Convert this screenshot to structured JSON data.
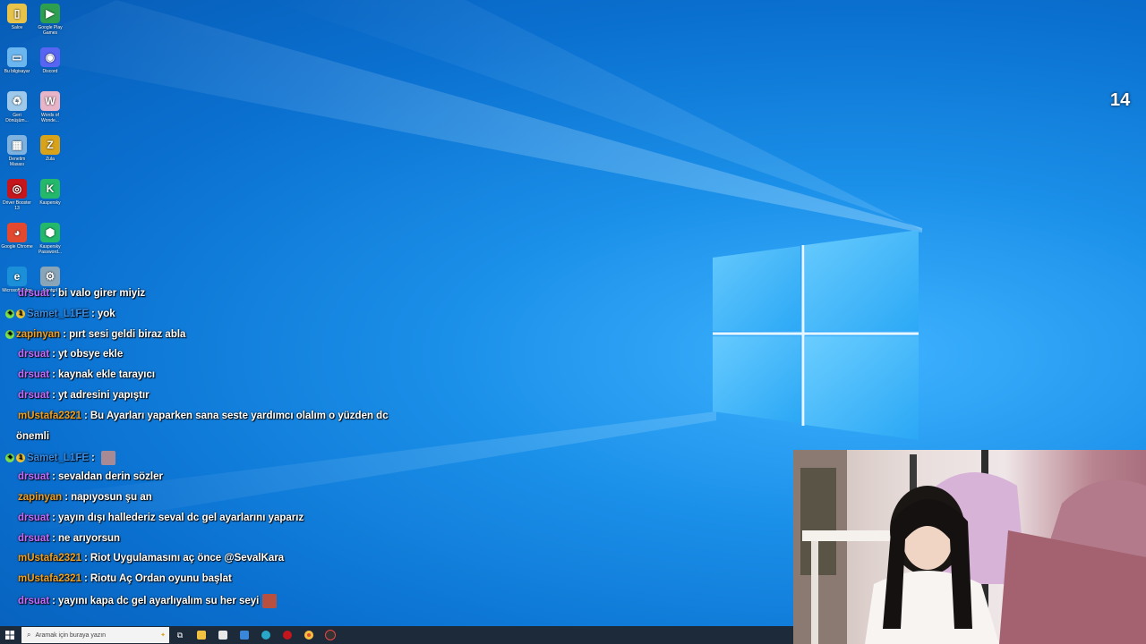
{
  "desktop": {
    "counter": "14",
    "icons": [
      {
        "label": "Salov",
        "color": "#e8c34a",
        "glyph": "▯"
      },
      {
        "label": "Google Play Games",
        "color": "#2e9e4f",
        "glyph": "▶"
      },
      {
        "label": "Bu bilgisayar",
        "color": "#6cb6f0",
        "glyph": "▭"
      },
      {
        "label": "Discord",
        "color": "#5865f2",
        "glyph": "◉"
      },
      {
        "label": "Geri Dönüşüm...",
        "color": "#9ec9ea",
        "glyph": "♻"
      },
      {
        "label": "Words of Wonde...",
        "color": "#e8b4c8",
        "glyph": "W"
      },
      {
        "label": "Denetim Masası",
        "color": "#7fb2df",
        "glyph": "▦"
      },
      {
        "label": "Zula",
        "color": "#d9a21b",
        "glyph": "Z"
      },
      {
        "label": "Driver Booster 13",
        "color": "#c4161c",
        "glyph": "◎"
      },
      {
        "label": "Kaspersky",
        "color": "#23b86a",
        "glyph": "K"
      },
      {
        "label": "Google Chrome",
        "color": "#e2492f",
        "glyph": "◕"
      },
      {
        "label": "Kaspersky Password...",
        "color": "#23b86a",
        "glyph": "⬢"
      },
      {
        "label": "Microsoft Edge",
        "color": "#1b8fd8",
        "glyph": "e"
      },
      {
        "label": "Kontrol",
        "color": "#8aa4b8",
        "glyph": "⚙"
      }
    ]
  },
  "chat": {
    "messages": [
      {
        "user": "drsuat",
        "user_color": "#c46cff",
        "text": "bi valo girer miyiz",
        "badges": []
      },
      {
        "user": "Samet_L1FE",
        "user_color": "#3a8ee6",
        "text": "yok",
        "badges": [
          "green",
          "gold"
        ]
      },
      {
        "user": "zapinyan",
        "user_color": "#f0a020",
        "text": "pırt sesi geldi biraz abla",
        "badges": [
          "green"
        ]
      },
      {
        "user": "drsuat",
        "user_color": "#c46cff",
        "text": "yt obsye ekle",
        "badges": []
      },
      {
        "user": "drsuat",
        "user_color": "#c46cff",
        "text": "kaynak ekle tarayıcı",
        "badges": []
      },
      {
        "user": "drsuat",
        "user_color": "#c46cff",
        "text": "yt adresini yapıştır",
        "badges": []
      },
      {
        "user": "mUstafa2321",
        "user_color": "#f0a020",
        "text": "Bu Ayarları yaparken sana seste yardımcı olalım o yüzden dc",
        "badges": []
      },
      {
        "user": "",
        "user_color": "#ffffff",
        "text": "önemli",
        "badges": []
      },
      {
        "user": "Samet_L1FE",
        "user_color": "#3a8ee6",
        "text": "",
        "badges": [
          "green",
          "gold"
        ],
        "emote": true
      },
      {
        "user": "drsuat",
        "user_color": "#c46cff",
        "text": "sevaldan derin sözler",
        "badges": []
      },
      {
        "user": "zapinyan",
        "user_color": "#f0a020",
        "text": "napıyosun şu an",
        "badges": []
      },
      {
        "user": "drsuat",
        "user_color": "#c46cff",
        "text": "yayın dışı hallederiz seval dc gel ayarlarını yaparız",
        "badges": []
      },
      {
        "user": "drsuat",
        "user_color": "#c46cff",
        "text": "ne arıyorsun",
        "badges": []
      },
      {
        "user": "mUstafa2321",
        "user_color": "#f0a020",
        "text": "Riot Uygulamasını aç önce @SevalKara",
        "badges": []
      },
      {
        "user": "mUstafa2321",
        "user_color": "#f0a020",
        "text": "Riotu Aç Ordan oyunu başlat",
        "badges": []
      },
      {
        "user": "drsuat",
        "user_color": "#c46cff",
        "text": "yayını kapa dc gel ayarlıyalım su her seyi",
        "badges": [],
        "emote": true
      }
    ],
    "separator": ":"
  },
  "taskbar": {
    "search_placeholder": "Aramak için buraya yazın",
    "apps": [
      "task-view",
      "file-explorer",
      "store",
      "mail",
      "edge",
      "app-red",
      "chrome",
      "app-obs"
    ]
  }
}
